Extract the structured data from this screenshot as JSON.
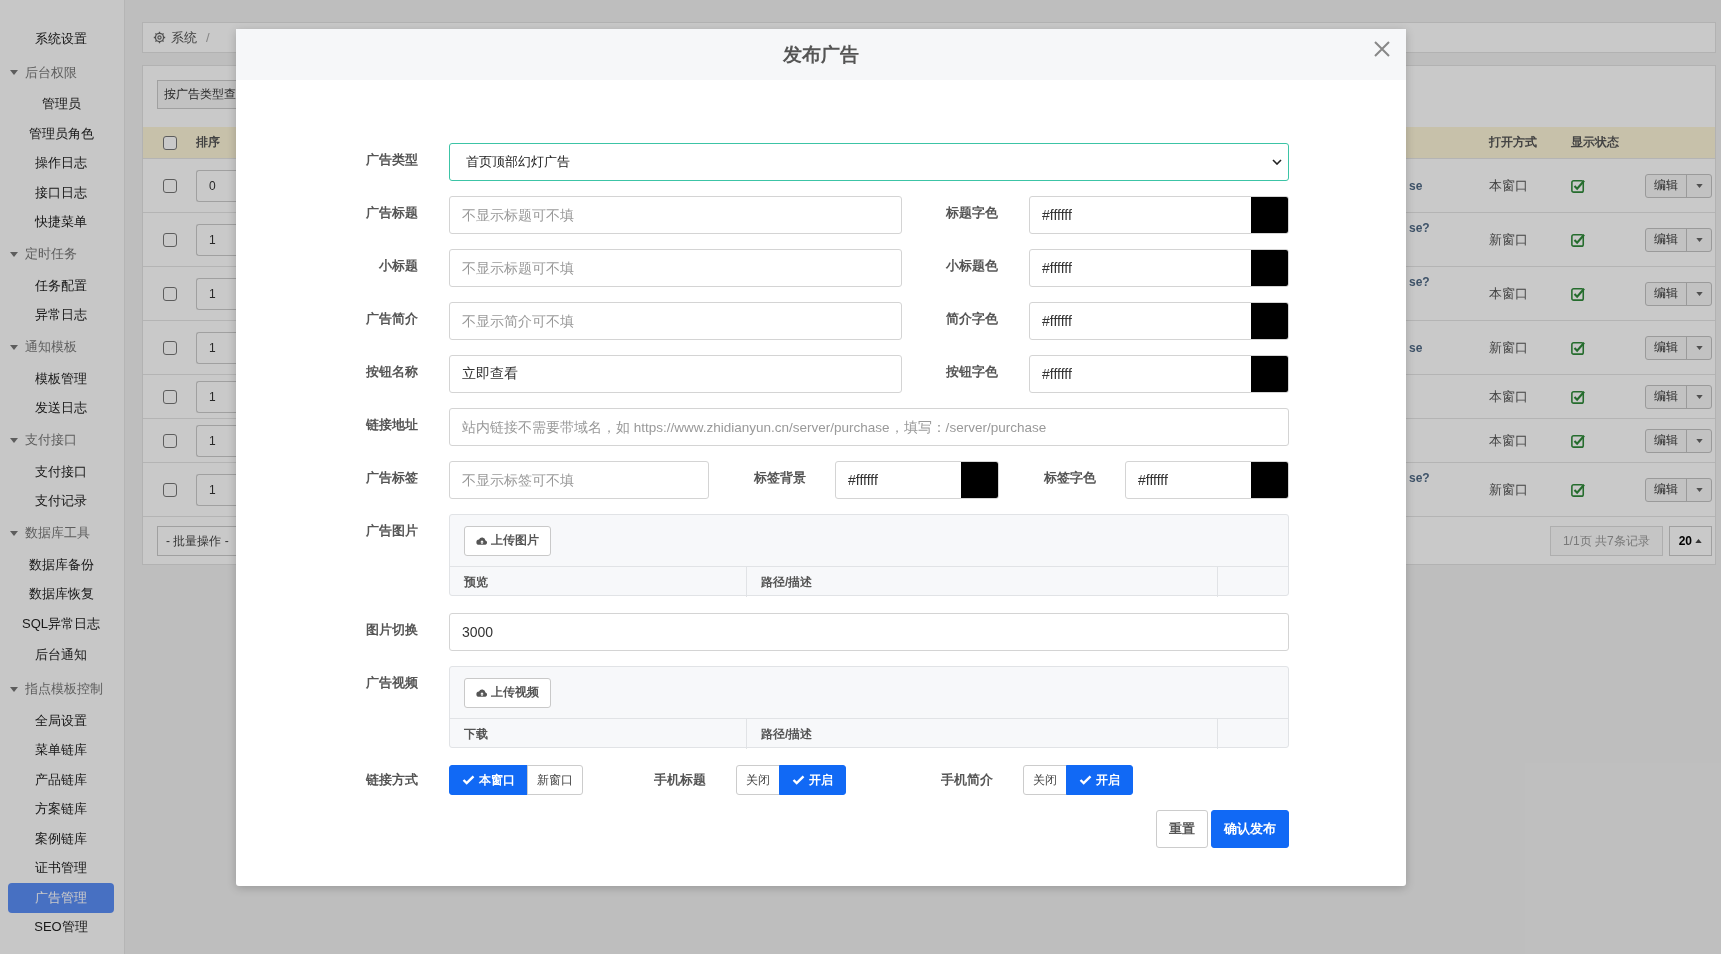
{
  "sidebar": {
    "items": [
      {
        "label": "系统设置",
        "selected": false
      },
      {
        "label": "后台权限",
        "expanded": true,
        "children": [
          {
            "label": "管理员",
            "selected": false
          },
          {
            "label": "管理员角色",
            "selected": false
          },
          {
            "label": "操作日志",
            "selected": false
          },
          {
            "label": "接口日志",
            "selected": false
          },
          {
            "label": "快捷菜单",
            "selected": false
          }
        ]
      },
      {
        "label": "定时任务",
        "expanded": true,
        "children": [
          {
            "label": "任务配置",
            "selected": false
          },
          {
            "label": "异常日志",
            "selected": false
          }
        ]
      },
      {
        "label": "通知模板",
        "expanded": true,
        "children": [
          {
            "label": "模板管理",
            "selected": false
          },
          {
            "label": "发送日志",
            "selected": false
          }
        ]
      },
      {
        "label": "支付接口",
        "expanded": true,
        "children": [
          {
            "label": "支付接口",
            "selected": false
          },
          {
            "label": "支付记录",
            "selected": false
          }
        ]
      },
      {
        "label": "数据库工具",
        "expanded": true,
        "children": [
          {
            "label": "数据库备份",
            "selected": false
          },
          {
            "label": "数据库恢复",
            "selected": false
          },
          {
            "label": "SQL异常日志",
            "selected": false
          }
        ]
      },
      {
        "label": "后台通知",
        "selected": false
      },
      {
        "label": "指点模板控制",
        "expanded": true,
        "children": [
          {
            "label": "全局设置",
            "selected": false
          },
          {
            "label": "菜单链库",
            "selected": false
          },
          {
            "label": "产品链库",
            "selected": false
          },
          {
            "label": "方案链库",
            "selected": false
          },
          {
            "label": "案例链库",
            "selected": false
          },
          {
            "label": "证书管理",
            "selected": false
          },
          {
            "label": "广告管理",
            "selected": true
          },
          {
            "label": "SEO管理",
            "selected": false
          }
        ]
      }
    ]
  },
  "breadcrumb": {
    "items": [
      "系统"
    ],
    "separator": "/"
  },
  "toolbar": {
    "search_button": "按广告类型查"
  },
  "table": {
    "header": {
      "checked": false,
      "sort": "排序",
      "open_mode": "打开方式",
      "visible": "显示状态"
    },
    "rows": [
      {
        "checked": false,
        "sort": "0",
        "column_3": "se",
        "open_mode": "本窗口",
        "visible": true,
        "action": "编辑"
      },
      {
        "checked": false,
        "sort": "1",
        "column_3": "se?",
        "open_mode": "新窗口",
        "visible": true,
        "action": "编辑"
      },
      {
        "checked": false,
        "sort": "1",
        "column_3": "se?",
        "open_mode": "本窗口",
        "visible": true,
        "action": "编辑"
      },
      {
        "checked": false,
        "sort": "1",
        "column_3": "se",
        "open_mode": "新窗口",
        "visible": true,
        "action": "编辑"
      },
      {
        "checked": false,
        "sort": "1",
        "open_mode": "本窗口",
        "visible": true,
        "action": "编辑"
      },
      {
        "checked": false,
        "sort": "1",
        "open_mode": "本窗口",
        "visible": true,
        "action": "编辑"
      },
      {
        "checked": false,
        "sort": "1",
        "column_3": "se?",
        "open_mode": "新窗口",
        "visible": true,
        "action": "编辑"
      }
    ]
  },
  "footer": {
    "batch": "- 批量操作 -",
    "page_info": "1/1页 共7条记录",
    "page_size": "20"
  },
  "modal": {
    "title": "发布广告",
    "rows": [
      {
        "kind": "select",
        "label": "广告类型",
        "value": "首页顶部幻灯广告"
      },
      {
        "kind": "input",
        "label": "广告标题",
        "placeholder": "不显示标题可不填",
        "colors": [
          {
            "label": "标题字色",
            "value": "#ffffff",
            "color": "#000000"
          }
        ]
      },
      {
        "kind": "input",
        "label": "小标题",
        "placeholder": "不显示标题可不填",
        "colors": [
          {
            "label": "小标题色",
            "value": "#ffffff",
            "color": "#000000"
          }
        ]
      },
      {
        "kind": "input",
        "label": "广告简介",
        "placeholder": "不显示简介可不填",
        "colors": [
          {
            "label": "简介字色",
            "value": "#ffffff",
            "color": "#000000"
          }
        ]
      },
      {
        "kind": "input",
        "label": "按钮名称",
        "value": "立即查看",
        "colors": [
          {
            "label": "按钮字色",
            "value": "#ffffff",
            "color": "#000000"
          }
        ]
      },
      {
        "kind": "input",
        "label": "链接地址",
        "placeholder": "站内链接不需要带域名，如 https://www.zhidianyun.cn/server/purchase，填写：/server/purchase"
      },
      {
        "kind": "input",
        "label": "广告标签",
        "placeholder": "不显示标签可不填",
        "colors": [
          {
            "label": "标签背景",
            "value": "#ffffff",
            "color": "#000000"
          },
          {
            "label": "标签字色",
            "value": "#ffffff",
            "color": "#000000"
          }
        ]
      },
      {
        "kind": "upload",
        "label": "广告图片",
        "button": "上传图片",
        "columns": [
          "预览",
          "路径/描述"
        ]
      },
      {
        "kind": "input",
        "label": "图片切换",
        "value": "3000"
      },
      {
        "kind": "upload",
        "label": "广告视频",
        "button": "上传视频",
        "columns": [
          "下载",
          "路径/描述"
        ]
      },
      {
        "kind": "toggles",
        "groups": [
          {
            "label": "链接方式",
            "options": [
              {
                "label": "本窗口",
                "selected": true
              },
              {
                "label": "新窗口",
                "selected": false
              }
            ]
          },
          {
            "label": "手机标题",
            "options": [
              {
                "label": "关闭",
                "selected": false
              },
              {
                "label": "开启",
                "selected": true
              }
            ]
          },
          {
            "label": "手机简介",
            "options": [
              {
                "label": "关闭",
                "selected": false
              },
              {
                "label": "开启",
                "selected": true
              }
            ]
          }
        ]
      }
    ],
    "buttons": [
      {
        "label": "重置",
        "kind": "secondary"
      },
      {
        "label": "确认发布",
        "kind": "primary"
      }
    ]
  }
}
